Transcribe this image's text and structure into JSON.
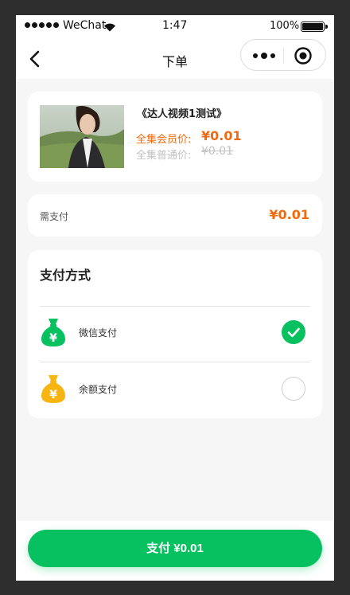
{
  "status_bar": {
    "carrier": "WeChat",
    "time": "1:47",
    "battery": "100%"
  },
  "nav": {
    "title": "下单"
  },
  "product": {
    "name": "《达人视频1测试》",
    "member_price_label": "全集会员价:",
    "member_price": "¥0.01",
    "normal_price_label": "全集普通价:",
    "normal_price": "¥0.01"
  },
  "payment_due": {
    "label": "需支付",
    "amount": "¥0.01"
  },
  "payment_methods": {
    "title": "支付方式",
    "options": [
      {
        "label": "微信支付",
        "icon": "money-bag-green-icon",
        "color": "#07c160",
        "selected": true
      },
      {
        "label": "余额支付",
        "icon": "money-bag-yellow-icon",
        "color": "#f8b512",
        "selected": false
      }
    ]
  },
  "footer": {
    "pay_button": "支付 ¥0.01"
  },
  "colors": {
    "accent_green": "#07c160",
    "price_orange": "#f06a0e",
    "balance_yellow": "#f8b512"
  }
}
